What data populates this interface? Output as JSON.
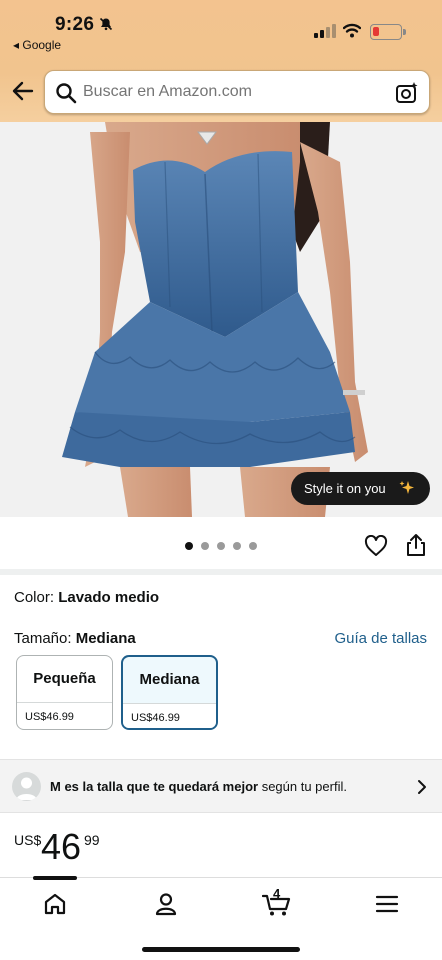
{
  "status_bar": {
    "time": "9:26",
    "back_app": "◂ Google"
  },
  "search": {
    "placeholder": "Buscar en Amazon.com"
  },
  "image": {
    "style_button": "Style it on you",
    "dot_count": 5,
    "active_dot": 0
  },
  "product": {
    "color_label": "Color:",
    "color_value": "Lavado medio",
    "size_label": "Tamaño:",
    "size_value": "Mediana",
    "size_guide": "Guía de tallas",
    "options": [
      {
        "label": "Pequeña",
        "price": "US$46.99",
        "selected": false
      },
      {
        "label": "Mediana",
        "price": "US$46.99",
        "selected": true
      }
    ]
  },
  "fit_banner": {
    "bold": "M es la talla que te quedará mejor",
    "rest": " según tu perfil."
  },
  "price": {
    "currency": "US$",
    "whole": "46",
    "fraction": "99"
  },
  "nav": {
    "cart_count": "4"
  },
  "colors": {
    "accent": "#1f5f8b",
    "header": "#f3c38f",
    "denim": "#3f6a9c"
  }
}
